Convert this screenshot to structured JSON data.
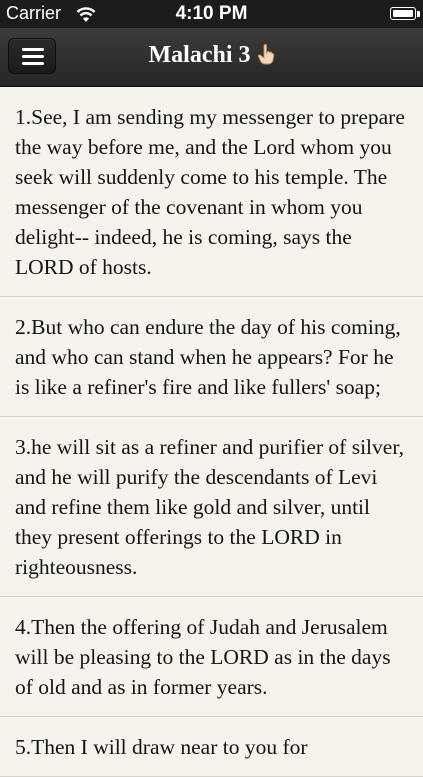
{
  "status_bar": {
    "carrier": "Carrier",
    "time": "4:10 PM"
  },
  "nav": {
    "title": "Malachi 3"
  },
  "verses": [
    {
      "text": "1.See, I am sending my messenger to prepare the way before me, and the Lord whom you seek will suddenly come to his temple. The messenger of the covenant in whom you delight-- indeed, he is coming, says the LORD of hosts."
    },
    {
      "text": "2.But who can endure the day of his coming, and who can stand when he appears? For he is like a refiner's fire and like fullers' soap;"
    },
    {
      "text": "3.he will sit as a refiner and purifier of silver, and he will purify the descendants of Levi and refine them like gold and silver, until they present offerings to the LORD in righteousness."
    },
    {
      "text": "4.Then the offering of Judah and Jerusalem will be pleasing to the LORD as in the days of old and as in former years."
    },
    {
      "text": "5.Then I will draw near to you for"
    }
  ],
  "colors": {
    "background": "#f6f3ec",
    "nav_background": "#2e2e2e",
    "text": "#141414"
  },
  "icons": {
    "menu": "hamburger-icon",
    "title_hint": "pointing-hand-icon",
    "wifi": "wifi-icon",
    "battery": "battery-icon"
  }
}
